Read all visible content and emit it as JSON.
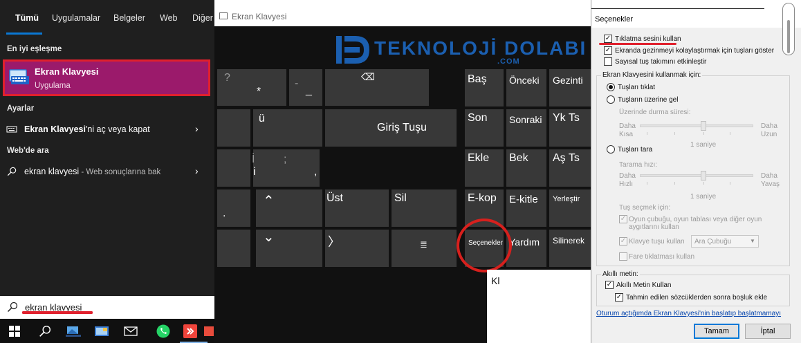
{
  "start_menu": {
    "tabs": [
      "Tümü",
      "Uygulamalar",
      "Belgeler",
      "Web",
      "Diğer"
    ],
    "best_match_label": "En iyi eşleşme",
    "best_match": {
      "title": "Ekran Klavyesi",
      "subtitle": "Uygulama"
    },
    "settings_label": "Ayarlar",
    "settings_item": {
      "bold": "Ekran Klavyesi",
      "rest": "'ni aç veya kapat"
    },
    "web_label": "Web'de ara",
    "web_item": {
      "bold": "ekran klavyesi",
      "rest": " - Web sonuçlarına bak"
    },
    "search_value": "ekran klavyesi"
  },
  "taskbar": {
    "icons": [
      "windows-start-icon",
      "search-icon",
      "app-icon",
      "mail-app-icon",
      "mail-icon",
      "whatsapp-icon",
      "anydesk-icon",
      "photos-icon"
    ]
  },
  "keyboard": {
    "window_title": "Ekran Klavyesi",
    "keys": {
      "question": "?",
      "star": "*",
      "underscore_shift": "_",
      "dash": "-",
      "backspace": "⌫",
      "u_umlaut": "ü",
      "enter": "Giriş Tuşu",
      "i_dotted_shift": "İ",
      "i_dotted": "i",
      "semicolon_shift": ";",
      "comma": ",",
      "dot": ".",
      "up": "⌃",
      "ust": "Üst",
      "sil": "Sil",
      "down": "⌄",
      "right": "〉",
      "menu_glyph": "≣",
      "bas": "Baş",
      "onceki": "Önceki",
      "gezinti": "Gezinti",
      "son": "Son",
      "sonraki": "Sonraki",
      "yk_ts": "Yk Ts",
      "ekle": "Ekle",
      "bek": "Bek",
      "as_ts": "Aş Ts",
      "e_kop": "E-kop",
      "e_kitle": "E-kitle",
      "yerlestir": "Yerleştir",
      "secenekler": "Seçenekler",
      "yardim": "Yardım",
      "silinerek": "Silinerek"
    },
    "bottom_partial_text": "Kl"
  },
  "logo": {
    "text": "TEKNOLOJİ DOLABI",
    "sub": ".COM",
    "color": "#1b5fb0"
  },
  "options_dialog": {
    "title": "Seçenekler",
    "close": "✕",
    "cb_click_sound": "Tıklatma sesini kullan",
    "cb_nav_keys": "Ekranda gezinmeyi kolaylaştırmak için tuşları göster",
    "cb_numpad": "Sayısal tuş takımını etkinleştir",
    "use_group_label": "Ekran Klavyesini kullanmak için:",
    "rb_click": "Tuşları tıklat",
    "rb_hover": "Tuşların üzerine gel",
    "hover_duration_label": "Üzerinde durma süresi:",
    "hover_short_1": "Daha",
    "hover_short_2": "Kısa",
    "hover_long_1": "Daha",
    "hover_long_2": "Uzun",
    "hover_value": "1 saniye",
    "rb_scan": "Tuşları tara",
    "scan_speed_label": "Tarama hızı:",
    "scan_fast_1": "Daha",
    "scan_fast_2": "Hızlı",
    "scan_slow_1": "Daha",
    "scan_slow_2": "Yavaş",
    "scan_value": "1 saniye",
    "key_select_label": "Tuş seçmek için:",
    "cb_gamepad_1": "Oyun çubuğu, oyun tablası veya diğer oyun",
    "cb_gamepad_2": "aygıtlarını kullan",
    "cb_keyboard_key": "Klavye tuşu kullan",
    "dropdown_value": "Ara Çubuğu",
    "cb_mouse_click": "Fare tıklatması kullan",
    "smart_text_label": "Akıllı metin:",
    "cb_smart_text": "Akıllı Metin Kullan",
    "cb_space_after": "Tahmin edilen sözcüklerden sonra boşluk ekle",
    "link_text": "Oturum açtığımda Ekran Klavyesi'nin başlatıp başlatmamayı",
    "btn_ok": "Tamam",
    "btn_cancel": "İptal"
  },
  "colors": {
    "accent_blue": "#0a78d4",
    "best_match_bg": "#9b1a6b",
    "highlight_red": "#e0202d",
    "key_bg": "#383838"
  }
}
